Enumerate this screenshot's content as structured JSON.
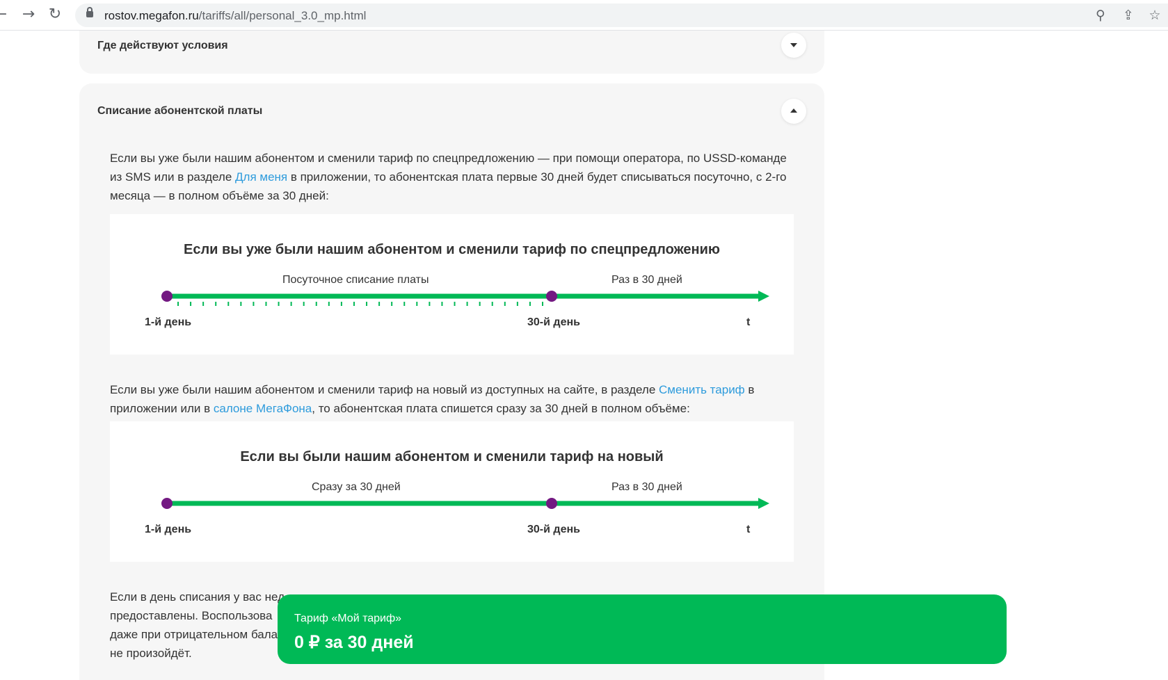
{
  "browser": {
    "url_host": "rostov.megafon.ru",
    "url_path": "/tariffs/all/personal_3.0_mp.html"
  },
  "accordion": {
    "collapsed_title": "Где действуют условия",
    "expanded_title": "Списание абонентской платы"
  },
  "intro": {
    "part1": "Если вы уже были нашим абонентом и сменили тариф по спецпредложению — при помощи оператора, по USSD-команде из SMS или в разделе ",
    "link": "Для меня",
    "part2": " в приложении, то абонентская плата первые 30 дней будет списываться посуточно, с 2-го месяца — в полном объёме за 30 дней:"
  },
  "diagram1": {
    "title": "Если вы уже были нашим абонентом и сменили тариф по спецпредложению",
    "segment1": "Посуточное списание платы",
    "segment2": "Раз в 30 дней",
    "day_start": "1-й день",
    "day_mid": "30-й день",
    "axis_end": "t"
  },
  "middle": {
    "part1": "Если вы уже были нашим абонентом и сменили тариф на новый из доступных на сайте, в разделе ",
    "link1": "Сменить тариф",
    "part2": " в приложении или в ",
    "link2": "салоне МегаФона",
    "part3": ", то абонентская плата спишется сразу за 30 дней в полном объёме:"
  },
  "diagram2": {
    "title": "Если вы были нашим абонентом и сменили тариф на новый",
    "segment1": "Сразу за 30 дней",
    "segment2": "Раз в 30 дней",
    "day_start": "1-й день",
    "day_mid": "30-й день",
    "axis_end": "t"
  },
  "bottom": {
    "line1": "Если в день списания у вас нед",
    "line2": "предоставлены. Воспользова",
    "line3": "даже при отрицательном бала",
    "line4": "не произойдёт."
  },
  "sticky": {
    "tariff_name": "Тариф «Мой тариф»",
    "price": "0 ₽ за 30 дней"
  },
  "colors": {
    "green": "#00b956",
    "purple": "#731982",
    "link": "#2d9bdc"
  }
}
